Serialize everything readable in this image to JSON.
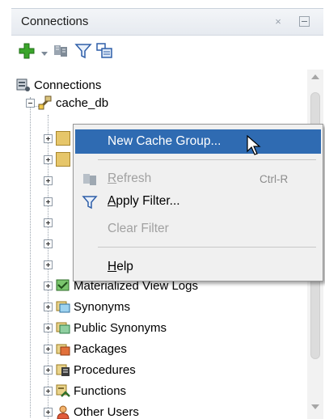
{
  "panel": {
    "title": "Connections",
    "close_glyph": "×"
  },
  "toolbar": {
    "icons": [
      "add-connection-icon",
      "dropdown-arrow-icon",
      "refresh-icon",
      "filter-icon",
      "cache-group-icon"
    ]
  },
  "tree": {
    "root_label": "Connections",
    "connection_label": "cache_db",
    "children": [
      {
        "label": "Materialized View Logs",
        "icon": "materialized-view-logs-icon"
      },
      {
        "label": "Synonyms",
        "icon": "synonyms-icon"
      },
      {
        "label": "Public Synonyms",
        "icon": "public-synonyms-icon"
      },
      {
        "label": "Packages",
        "icon": "packages-icon"
      },
      {
        "label": "Procedures",
        "icon": "procedures-icon"
      },
      {
        "label": "Functions",
        "icon": "functions-icon"
      },
      {
        "label": "Other Users",
        "icon": "other-users-icon"
      }
    ]
  },
  "context_menu": {
    "new_cache_group": "New Cache Group...",
    "refresh": {
      "label_u": "R",
      "label_rest": "efresh",
      "accel": "Ctrl-R"
    },
    "apply_filter": {
      "label_u": "A",
      "label_rest": "pply Filter..."
    },
    "clear_filter": "Clear Filter",
    "help": {
      "label_u": "H",
      "label_rest": "elp"
    }
  },
  "colors": {
    "selection": "#2f6bb2",
    "menu_bg": "#f0f0f0",
    "disabled_text": "#a1a1a1"
  }
}
